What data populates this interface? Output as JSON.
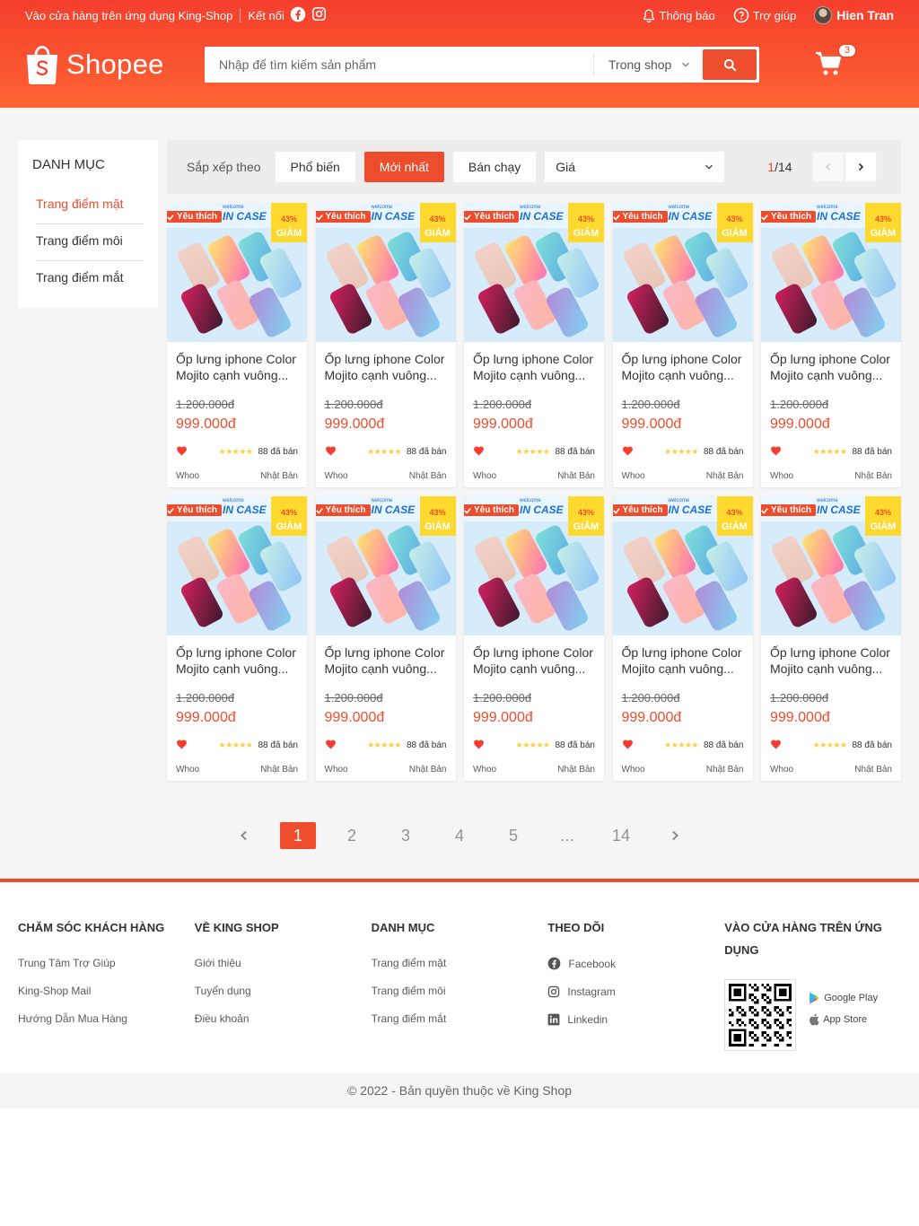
{
  "nav": {
    "app_link": "Vào cửa hàng trên ứng dụng King-Shop",
    "connect": "Kết nối",
    "notifications": "Thông báo",
    "help": "Trợ giúp",
    "user_name": "Hien Tran"
  },
  "header": {
    "logo_text": "Shopee",
    "search_placeholder": "Nhập để tìm kiếm sản phẩm",
    "search_scope": "Trong shop",
    "cart_count": "3"
  },
  "sidebar": {
    "title": "DANH MỤC",
    "items": [
      {
        "label": "Trang điểm mặt",
        "active": true
      },
      {
        "label": "Trang điểm môi",
        "active": false
      },
      {
        "label": "Trang điểm mắt",
        "active": false
      }
    ]
  },
  "filter": {
    "label": "Sắp xếp theo",
    "options": [
      "Phổ biến",
      "Mới nhất",
      "Bán chạy"
    ],
    "active": "Mới nhất",
    "price_select": "Giá",
    "page_current": "1",
    "page_total": "/14"
  },
  "product": {
    "like_tag": "Yêu thích",
    "banner_small": "welcome",
    "banner_text": "IN CASE",
    "sale_percent": "43%",
    "sale_word": "GIẢM",
    "name": "Ốp lưng iphone Color Mojito cạnh vuông...",
    "old_price": "1.200.000đ",
    "current_price": "999.000đ",
    "rating_stars": "★★★★★",
    "sold": "88 đã bán",
    "brand": "Whoo",
    "origin": "Nhật Bản"
  },
  "products_count": 10,
  "pagination": {
    "pages": [
      "1",
      "2",
      "3",
      "4",
      "5",
      "...",
      "14"
    ],
    "active": "1"
  },
  "footer": {
    "columns": [
      {
        "title": "CHĂM SÓC KHÁCH HÀNG",
        "items": [
          "Trung Tâm Trợ Giúp",
          "King-Shop Mail",
          "Hướng Dẫn Mua Hàng"
        ]
      },
      {
        "title": "VỀ KING SHOP",
        "items": [
          "Giới thiệu",
          "Tuyển dụng",
          "Điều khoản"
        ]
      },
      {
        "title": "DANH MỤC",
        "items": [
          "Trang điểm mặt",
          "Trang điểm môi",
          "Trang điểm mắt"
        ]
      },
      {
        "title": "THEO DÕI",
        "items": [
          "Facebook",
          "Instagram",
          "Linkedin"
        ]
      },
      {
        "title": "VÀO CỬA HÀNG TRÊN ỨNG DỤNG",
        "stores": [
          "Google Play",
          "App Store"
        ]
      }
    ],
    "copyright": "© 2022 - Bản quyền thuộc về King Shop"
  },
  "colors": {
    "brand": "#ee4d2d",
    "header_gradient_start": "#f53e2d",
    "header_gradient_end": "#fe6433",
    "rating": "#ffce3d"
  }
}
